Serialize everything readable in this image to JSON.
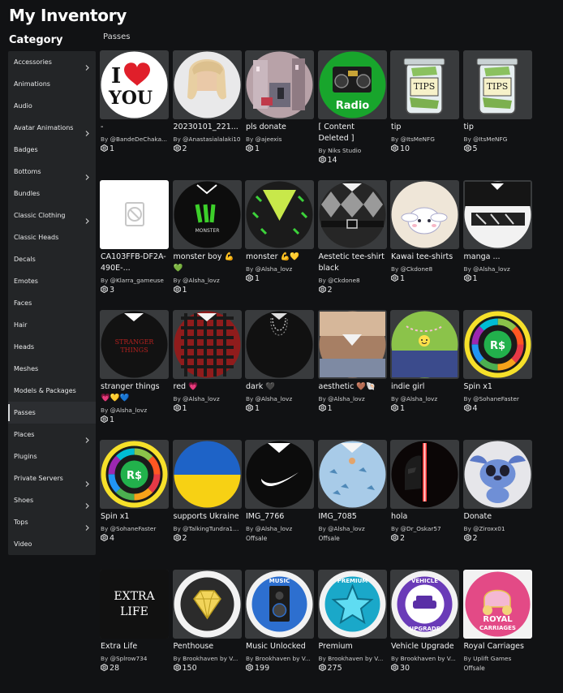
{
  "page": {
    "title": "My Inventory",
    "category_heading": "Category",
    "section_label": "Passes"
  },
  "sidebar": {
    "items": [
      {
        "label": "Accessories",
        "chevron": true
      },
      {
        "label": "Animations",
        "chevron": false
      },
      {
        "label": "Audio",
        "chevron": false
      },
      {
        "label": "Avatar Animations",
        "chevron": true
      },
      {
        "label": "Badges",
        "chevron": false
      },
      {
        "label": "Bottoms",
        "chevron": true
      },
      {
        "label": "Bundles",
        "chevron": false
      },
      {
        "label": "Classic Clothing",
        "chevron": true
      },
      {
        "label": "Classic Heads",
        "chevron": false
      },
      {
        "label": "Decals",
        "chevron": false
      },
      {
        "label": "Emotes",
        "chevron": false
      },
      {
        "label": "Faces",
        "chevron": false
      },
      {
        "label": "Hair",
        "chevron": false
      },
      {
        "label": "Heads",
        "chevron": false
      },
      {
        "label": "Meshes",
        "chevron": false
      },
      {
        "label": "Models & Packages",
        "chevron": false
      },
      {
        "label": "Passes",
        "chevron": false,
        "active": true
      },
      {
        "label": "Places",
        "chevron": true
      },
      {
        "label": "Plugins",
        "chevron": false
      },
      {
        "label": "Private Servers",
        "chevron": true
      },
      {
        "label": "Shoes",
        "chevron": true
      },
      {
        "label": "Tops",
        "chevron": true
      },
      {
        "label": "Video",
        "chevron": false
      }
    ]
  },
  "items": [
    {
      "name": "-",
      "creator": "@BandeDeChaka...",
      "price": "1",
      "icon": "i-love-you-heart"
    },
    {
      "name": "20230101_221...",
      "creator": "@Anastasialalaki10",
      "price": "2",
      "icon": "blonde-hair-avatar"
    },
    {
      "name": "pls donate",
      "creator": "@ajeexis",
      "price": "1",
      "icon": "city-street-photo"
    },
    {
      "name": "[ Content Deleted ]",
      "creator": "Niks Studio",
      "price": "14",
      "icon": "radio-boombox"
    },
    {
      "name": "tip",
      "creator": "@ItsMeNFG",
      "price": "10",
      "icon": "tips-jar"
    },
    {
      "name": "tip",
      "creator": "@ItsMeNFG",
      "price": "5",
      "icon": "tips-jar"
    },
    {
      "name": "CA103FFB-DF2A-490E-...",
      "creator": "@Klarra_gameuse",
      "price": "3",
      "icon": "broken-image"
    },
    {
      "name": "monster boy 💪💚",
      "creator": "@Alsha_lovz",
      "price": "1",
      "icon": "monster-energy-shirt"
    },
    {
      "name": "monster 💪💛",
      "creator": "@Alsha_lovz",
      "price": "1",
      "icon": "monster-sweater"
    },
    {
      "name": "Aestetic tee-shirt black",
      "creator": "@Ckdone8",
      "price": "2",
      "icon": "argyle-shirt"
    },
    {
      "name": "Kawai tee-shirts",
      "creator": "@Ckdone8",
      "price": "1",
      "icon": "cinnamoroll-shirt"
    },
    {
      "name": "manga ...",
      "creator": "@Alsha_lovz",
      "price": "1",
      "icon": "manga-shirt"
    },
    {
      "name": "stranger things 💗💛💙",
      "creator": "@Alsha_lovz",
      "price": "1",
      "icon": "stranger-things-shirt"
    },
    {
      "name": "red 💗",
      "creator": "@Alsha_lovz",
      "price": "1",
      "icon": "red-plaid-shirt"
    },
    {
      "name": "dark 🖤",
      "creator": "@Alsha_lovz",
      "price": "1",
      "icon": "dark-chain-shirt"
    },
    {
      "name": "aesthetic 🤎🐚",
      "creator": "@Alsha_lovz",
      "price": "1",
      "icon": "brown-aesthetic-shirt"
    },
    {
      "name": "indie girl",
      "creator": "@Alsha_lovz",
      "price": "1",
      "icon": "indie-shirt"
    },
    {
      "name": "Spin x1",
      "creator": "@SohaneFaster",
      "price": "4",
      "icon": "robux-spin-wheel"
    },
    {
      "name": "Spin x1",
      "creator": "@SohaneFaster",
      "price": "4",
      "icon": "robux-spin-wheel"
    },
    {
      "name": "supports Ukraine",
      "creator": "@TalkingTundra13...",
      "price": "2",
      "icon": "ukraine-flag"
    },
    {
      "name": "IMG_7766",
      "creator": "@Alsha_lovz",
      "offsale": "Offsale",
      "icon": "nike-shirt"
    },
    {
      "name": "IMG_7085",
      "creator": "@Alsha_lovz",
      "offsale": "Offsale",
      "icon": "dino-shirt"
    },
    {
      "name": "hola",
      "creator": "@Dr_Oskar57",
      "price": "2",
      "icon": "darth-vader-lightsaber"
    },
    {
      "name": "Donate",
      "creator": "@Ziroxx01",
      "price": "2",
      "icon": "stitch"
    },
    {
      "name": "Extra Life",
      "creator": "@Splrow734",
      "price": "28",
      "icon": "extra-life-badge"
    },
    {
      "name": "Penthouse",
      "creator": "Brookhaven by V...",
      "price": "150",
      "icon": "diamond-badge"
    },
    {
      "name": "Music Unlocked",
      "creator": "Brookhaven by V...",
      "price": "199",
      "icon": "music-speaker-badge"
    },
    {
      "name": "Premium",
      "creator": "Brookhaven by V...",
      "price": "275",
      "icon": "premium-star-badge"
    },
    {
      "name": "Vehicle Upgrade",
      "creator": "Brookhaven by V...",
      "price": "30",
      "icon": "vehicle-upgrade-badge"
    },
    {
      "name": "Royal Carriages",
      "creator": "Uplift Games",
      "offsale": "Offsale",
      "icon": "royal-carriage-badge"
    }
  ],
  "colors": {
    "background": "#111214",
    "sidebar": "#232527",
    "thumb": "#393b3d",
    "text": "#f2f3f4"
  },
  "labels": {
    "by": "By"
  }
}
